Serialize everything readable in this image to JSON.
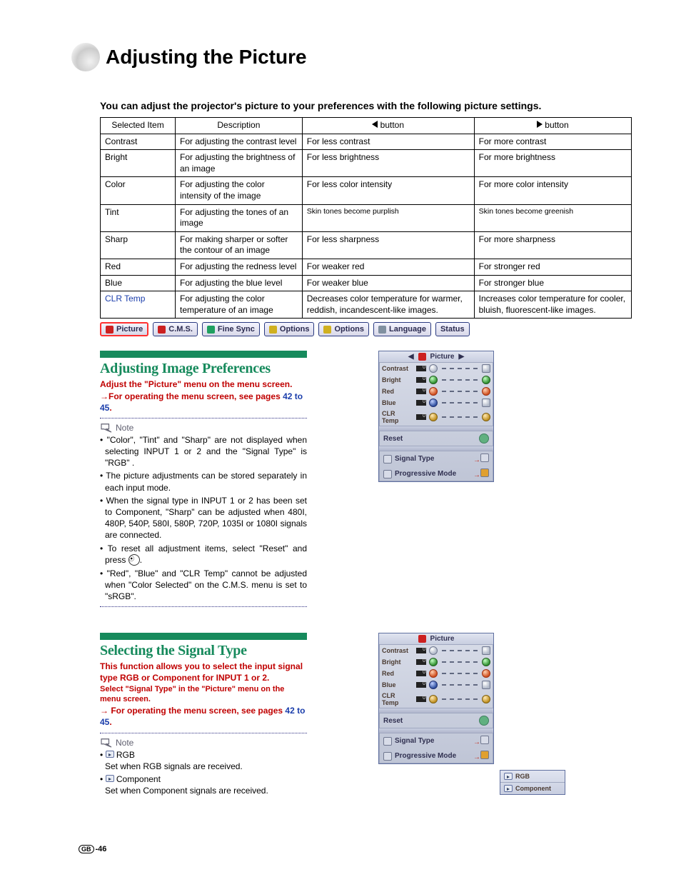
{
  "title": "Adjusting the Picture",
  "intro": "You can adjust the projector's picture to your preferences with the following picture settings.",
  "table": {
    "headers": {
      "item": "Selected Item",
      "desc": "Description",
      "left": "button",
      "right": "button"
    },
    "rows": [
      {
        "item": "Contrast",
        "desc": "For adjusting the contrast level",
        "l": "For less contrast",
        "r": "For more contrast"
      },
      {
        "item": "Bright",
        "desc": "For adjusting the brightness of an image",
        "l": "For less brightness",
        "r": "For more brightness"
      },
      {
        "item": "Color",
        "desc": "For adjusting the color intensity of the image",
        "l": "For less color intensity",
        "r": "For more color intensity"
      },
      {
        "item": "Tint",
        "desc": "For adjusting the tones of an image",
        "l": "Skin tones become purplish",
        "r": "Skin tones become greenish"
      },
      {
        "item": "Sharp",
        "desc": "For making sharper or softer the contour of an image",
        "l": "For less sharpness",
        "r": "For more sharpness"
      },
      {
        "item": "Red",
        "desc": "For adjusting the redness level",
        "l": "For weaker red",
        "r": "For stronger red"
      },
      {
        "item": "Blue",
        "desc": "For adjusting the blue level",
        "l": "For weaker blue",
        "r": "For stronger blue"
      },
      {
        "item": "CLR Temp",
        "desc": "For adjusting the color temperature of an image",
        "l": "Decreases color temperature for warmer, reddish, incandescent-like images.",
        "r": "Increases color temperature for cooler, bluish, fluorescent-like images."
      }
    ]
  },
  "tabs": [
    "Picture",
    "C.M.S.",
    "Fine Sync",
    "Options",
    "Options",
    "Language",
    "Status"
  ],
  "section1": {
    "heading": "Adjusting Image Preferences",
    "lead": "Adjust the \"Picture\" menu on the menu screen.",
    "sub_arrow": "→",
    "sub": "For operating the menu screen, see pages ",
    "sub_link": "42 to 45",
    "sub_end": ".",
    "note_label": "Note",
    "notes": [
      "\"Color\", \"Tint\" and \"Sharp\" are not displayed when selecting INPUT 1 or 2 and the \"Signal Type\" is \"RGB\" .",
      "The picture adjustments can be stored separately in each input mode.",
      "When the signal type in INPUT 1 or 2 has been set to Component, \"Sharp\" can be adjusted when 480I, 480P, 540P, 580I, 580P, 720P, 1035I or 1080I signals are connected.",
      "To reset all adjustment items, select \"Reset\" and press ",
      "\"Red\", \"Blue\" and \"CLR Temp\" cannot be adjusted when \"Color Selected\" on the C.M.S. menu is set to \"sRGB\"."
    ],
    "note4_end": "."
  },
  "section2": {
    "heading": "Selecting the Signal Type",
    "lead": "This function allows you to select the input signal type RGB or Component for INPUT 1 or 2.",
    "lead2": "Select \"Signal Type\" in the \"Picture\" menu on the menu screen.",
    "sub_arrow": "→ ",
    "sub": "For operating the menu screen, see pages ",
    "sub_link": "42 to 45",
    "sub_end": ".",
    "note_label": "Note",
    "opt1_label": "RGB",
    "opt1_desc": "Set when RGB signals are received.",
    "opt2_label": "Component",
    "opt2_desc": "Set when Component signals are received."
  },
  "osd": {
    "title": "Picture",
    "rows": [
      "Contrast",
      "Bright",
      "Red",
      "Blue",
      "CLR Temp"
    ],
    "reset": "Reset",
    "signal": "Signal Type",
    "prog": "Progressive Mode"
  },
  "popout": {
    "rgb": "RGB",
    "component": "Component"
  },
  "footer": {
    "gb": "GB",
    "page": "-46"
  }
}
